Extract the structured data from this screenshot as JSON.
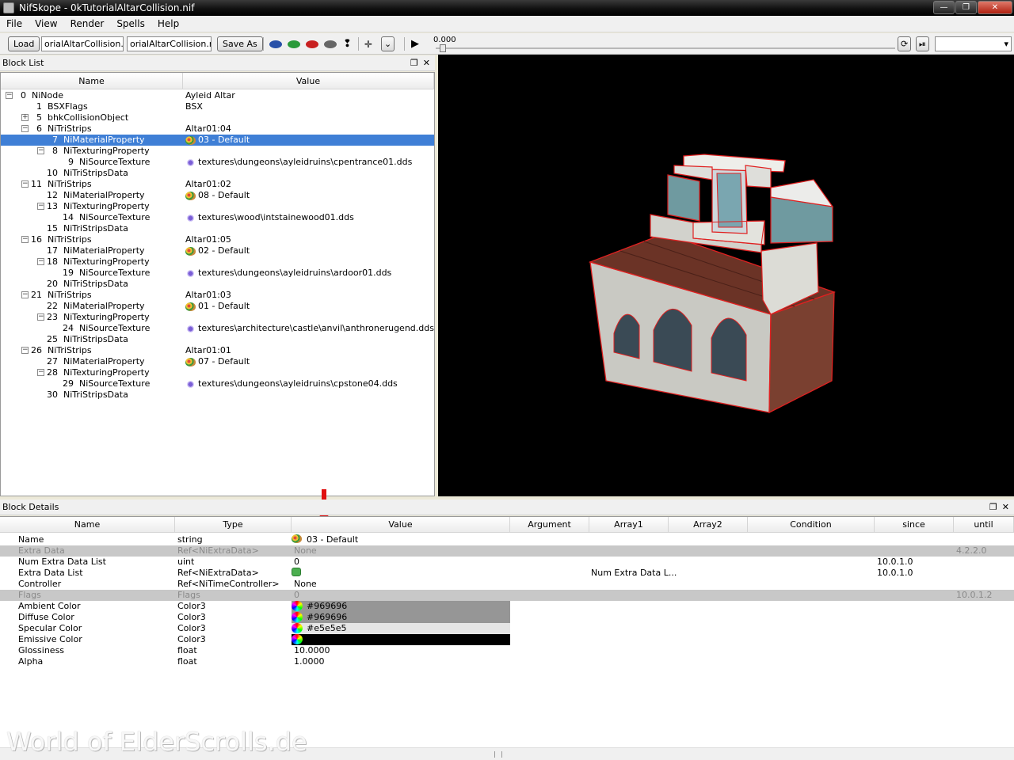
{
  "window": {
    "title": "NifSkope - 0kTutorialAltarCollision.nif"
  },
  "menu": [
    "File",
    "View",
    "Render",
    "Spells",
    "Help"
  ],
  "toolbar": {
    "load_label": "Load",
    "load_path": "orialAltarCollision.nif",
    "save_path": "orialAltarCollision.nif",
    "save_as_label": "Save As",
    "time_value": "0.000"
  },
  "block_list": {
    "title": "Block List",
    "columns": [
      "Name",
      "Value"
    ],
    "rows": [
      {
        "id": "0",
        "name": "NiNode",
        "value": "Ayleid Altar",
        "depth": 0,
        "expander": "minus",
        "icon": ""
      },
      {
        "id": "1",
        "name": "BSXFlags",
        "value": "BSX",
        "depth": 1,
        "expander": "",
        "icon": ""
      },
      {
        "id": "5",
        "name": "bhkCollisionObject",
        "value": "",
        "depth": 1,
        "expander": "plus",
        "icon": ""
      },
      {
        "id": "6",
        "name": "NiTriStrips",
        "value": "Altar01:04",
        "depth": 1,
        "expander": "minus",
        "icon": ""
      },
      {
        "id": "7",
        "name": "NiMaterialProperty",
        "value": "03 - Default",
        "depth": 2,
        "expander": "",
        "icon": "material",
        "selected": true
      },
      {
        "id": "8",
        "name": "NiTexturingProperty",
        "value": "",
        "depth": 2,
        "expander": "minus",
        "icon": ""
      },
      {
        "id": "9",
        "name": "NiSourceTexture",
        "value": "textures\\dungeons\\ayleidruins\\cpentrance01.dds",
        "depth": 3,
        "expander": "",
        "icon": "texture"
      },
      {
        "id": "10",
        "name": "NiTriStripsData",
        "value": "",
        "depth": 2,
        "expander": "",
        "icon": ""
      },
      {
        "id": "11",
        "name": "NiTriStrips",
        "value": "Altar01:02",
        "depth": 1,
        "expander": "minus",
        "icon": ""
      },
      {
        "id": "12",
        "name": "NiMaterialProperty",
        "value": "08 - Default",
        "depth": 2,
        "expander": "",
        "icon": "material"
      },
      {
        "id": "13",
        "name": "NiTexturingProperty",
        "value": "",
        "depth": 2,
        "expander": "minus",
        "icon": ""
      },
      {
        "id": "14",
        "name": "NiSourceTexture",
        "value": "textures\\wood\\intstainewood01.dds",
        "depth": 3,
        "expander": "",
        "icon": "texture"
      },
      {
        "id": "15",
        "name": "NiTriStripsData",
        "value": "",
        "depth": 2,
        "expander": "",
        "icon": ""
      },
      {
        "id": "16",
        "name": "NiTriStrips",
        "value": "Altar01:05",
        "depth": 1,
        "expander": "minus",
        "icon": ""
      },
      {
        "id": "17",
        "name": "NiMaterialProperty",
        "value": "02 - Default",
        "depth": 2,
        "expander": "",
        "icon": "material"
      },
      {
        "id": "18",
        "name": "NiTexturingProperty",
        "value": "",
        "depth": 2,
        "expander": "minus",
        "icon": ""
      },
      {
        "id": "19",
        "name": "NiSourceTexture",
        "value": "textures\\dungeons\\ayleidruins\\ardoor01.dds",
        "depth": 3,
        "expander": "",
        "icon": "texture"
      },
      {
        "id": "20",
        "name": "NiTriStripsData",
        "value": "",
        "depth": 2,
        "expander": "",
        "icon": ""
      },
      {
        "id": "21",
        "name": "NiTriStrips",
        "value": "Altar01:03",
        "depth": 1,
        "expander": "minus",
        "icon": ""
      },
      {
        "id": "22",
        "name": "NiMaterialProperty",
        "value": "01 - Default",
        "depth": 2,
        "expander": "",
        "icon": "material"
      },
      {
        "id": "23",
        "name": "NiTexturingProperty",
        "value": "",
        "depth": 2,
        "expander": "minus",
        "icon": ""
      },
      {
        "id": "24",
        "name": "NiSourceTexture",
        "value": "textures\\architecture\\castle\\anvil\\anthronerugend.dds",
        "depth": 3,
        "expander": "",
        "icon": "texture"
      },
      {
        "id": "25",
        "name": "NiTriStripsData",
        "value": "",
        "depth": 2,
        "expander": "",
        "icon": ""
      },
      {
        "id": "26",
        "name": "NiTriStrips",
        "value": "Altar01:01",
        "depth": 1,
        "expander": "minus",
        "icon": ""
      },
      {
        "id": "27",
        "name": "NiMaterialProperty",
        "value": "07 - Default",
        "depth": 2,
        "expander": "",
        "icon": "material"
      },
      {
        "id": "28",
        "name": "NiTexturingProperty",
        "value": "",
        "depth": 2,
        "expander": "minus",
        "icon": ""
      },
      {
        "id": "29",
        "name": "NiSourceTexture",
        "value": "textures\\dungeons\\ayleidruins\\cpstone04.dds",
        "depth": 3,
        "expander": "",
        "icon": "texture"
      },
      {
        "id": "30",
        "name": "NiTriStripsData",
        "value": "",
        "depth": 2,
        "expander": "",
        "icon": ""
      }
    ]
  },
  "block_details": {
    "title": "Block Details",
    "columns": [
      "Name",
      "Type",
      "Value",
      "Argument",
      "Array1",
      "Array2",
      "Condition",
      "since",
      "until"
    ],
    "rows": [
      {
        "name": "Name",
        "type": "string",
        "value": "03 - Default",
        "icon": "material",
        "argument": "",
        "array1": "",
        "since": "",
        "until": "",
        "grey": false,
        "color": ""
      },
      {
        "name": "Extra Data",
        "type": "Ref<NiExtraData>",
        "value": "None",
        "icon": "",
        "argument": "",
        "array1": "",
        "since": "",
        "until": "4.2.2.0",
        "grey": true,
        "color": ""
      },
      {
        "name": "Num Extra Data List",
        "type": "uint",
        "value": "0",
        "icon": "",
        "argument": "",
        "array1": "",
        "since": "10.0.1.0",
        "until": "",
        "grey": false,
        "color": ""
      },
      {
        "name": "Extra Data List",
        "type": "Ref<NiExtraData>",
        "value": "",
        "icon": "link",
        "argument": "",
        "array1": "Num Extra Data L...",
        "since": "10.0.1.0",
        "until": "",
        "grey": false,
        "color": ""
      },
      {
        "name": "Controller",
        "type": "Ref<NiTimeController>",
        "value": "None",
        "icon": "",
        "argument": "",
        "array1": "",
        "since": "",
        "until": "",
        "grey": false,
        "color": ""
      },
      {
        "name": "Flags",
        "type": "Flags",
        "value": "0",
        "icon": "",
        "argument": "",
        "array1": "",
        "since": "",
        "until": "10.0.1.2",
        "grey": true,
        "color": ""
      },
      {
        "name": "Ambient Color",
        "type": "Color3",
        "value": "#969696",
        "icon": "color",
        "argument": "",
        "array1": "",
        "since": "",
        "until": "",
        "grey": false,
        "color": "#969696"
      },
      {
        "name": "Diffuse Color",
        "type": "Color3",
        "value": "#969696",
        "icon": "color",
        "argument": "",
        "array1": "",
        "since": "",
        "until": "",
        "grey": false,
        "color": "#969696"
      },
      {
        "name": "Specular Color",
        "type": "Color3",
        "value": "#e5e5e5",
        "icon": "color",
        "argument": "",
        "array1": "",
        "since": "",
        "until": "",
        "grey": false,
        "color": "#e5e5e5"
      },
      {
        "name": "Emissive Color",
        "type": "Color3",
        "value": "",
        "icon": "color",
        "argument": "",
        "array1": "",
        "since": "",
        "until": "",
        "grey": false,
        "color": "#000000"
      },
      {
        "name": "Glossiness",
        "type": "float",
        "value": "10.0000",
        "icon": "",
        "argument": "",
        "array1": "",
        "since": "",
        "until": "",
        "grey": false,
        "color": ""
      },
      {
        "name": "Alpha",
        "type": "float",
        "value": "1.0000",
        "icon": "",
        "argument": "",
        "array1": "",
        "since": "",
        "until": "",
        "grey": false,
        "color": ""
      }
    ]
  },
  "watermark": "World of ElderScrolls.de",
  "colors": {
    "selection": "#3f7fd6",
    "viewport_bg": "#000000",
    "highlight_arrow": "#e01010"
  }
}
